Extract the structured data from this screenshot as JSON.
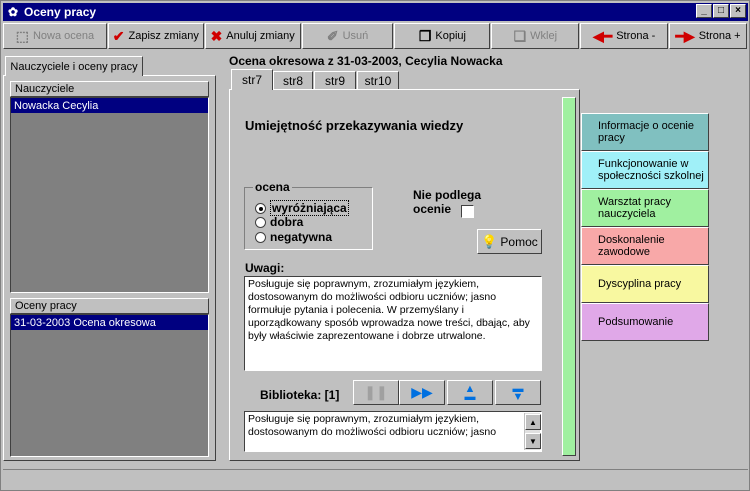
{
  "window": {
    "title": "Oceny pracy",
    "minimize": "_",
    "maximize": "□",
    "close": "×"
  },
  "toolbar": {
    "new_label": "Nowa ocena",
    "save_label": "Zapisz zmiany",
    "cancel_label": "Anuluj zmiany",
    "delete_label": "Usuń",
    "copy_label": "Kopiuj",
    "paste_label": "Wklej",
    "prev_label": "Strona -",
    "next_label": "Strona +"
  },
  "left": {
    "tab_label": "Nauczyciele i oceny pracy",
    "teachers_header": "Nauczyciele",
    "teachers": [
      "Nowacka Cecylia"
    ],
    "evals_header": "Oceny pracy",
    "evals": [
      "31-03-2003 Ocena okresowa"
    ]
  },
  "main": {
    "title": "Ocena okresowa z 31-03-2003, Cecylia Nowacka",
    "tabs": [
      "str7",
      "str8",
      "str9",
      "str10"
    ],
    "active_tab": "str7",
    "question": "Umiejętność przekazywania wiedzy",
    "rating_legend": "ocena",
    "options": [
      "wyróżniająca",
      "dobra",
      "negatywna"
    ],
    "selected_option": "wyróżniająca",
    "not_rated_line1": "Nie podlega",
    "not_rated_line2": "ocenie",
    "help_label": "Pomoc",
    "notes_label": "Uwagi:",
    "notes_text": "Posługuje się poprawnym, zrozumiałym językiem, dostosowanym do możliwości odbioru uczniów; jasno formułuje pytania i polecenia. W przemyślany i uporządkowany sposób wprowadza nowe treści, dbając, aby były właściwie zaprezentowane i dobrze utrwalone.",
    "library_label": "Biblioteka: [1]",
    "library_text": "Posługuje się poprawnym, zrozumiałym językiem, dostosowanym do możliwości odbioru uczniów; jasno"
  },
  "sections": [
    {
      "label": "Informacje o ocenie pracy",
      "color": "#80c0c0"
    },
    {
      "label": "Funkcjonowanie w społeczności szkolnej",
      "color": "#a0f0f8"
    },
    {
      "label": "Warsztat pracy nauczyciela",
      "color": "#a0f0a0"
    },
    {
      "label": "Doskonalenie zawodowe",
      "color": "#f8a8a8"
    },
    {
      "label": "Dyscyplina pracy",
      "color": "#f8f8a0"
    },
    {
      "label": "Podsumowanie",
      "color": "#e0a8e8"
    }
  ]
}
